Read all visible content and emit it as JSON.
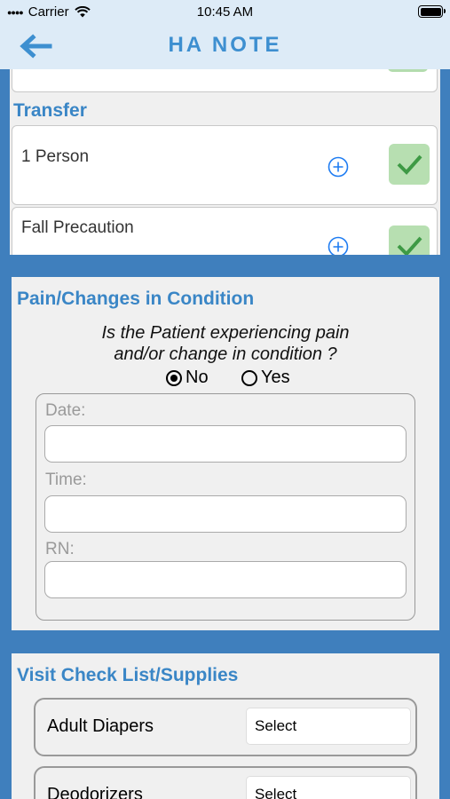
{
  "status_bar": {
    "carrier": "Carrier",
    "time": "10:45 AM"
  },
  "nav": {
    "title": "HA NOTE",
    "back_icon": "arrow-left-icon"
  },
  "transfer": {
    "title": "Transfer",
    "items": [
      {
        "label": "1 Person",
        "added_icon": "plus-circle-icon",
        "checked": true
      },
      {
        "label": "Fall Precaution",
        "added_icon": "plus-circle-icon",
        "checked": true
      }
    ]
  },
  "pain": {
    "title": "Pain/Changes in Condition",
    "question_line1": "Is the Patient experiencing pain",
    "question_line2": "and/or change in condition ?",
    "options": [
      {
        "label": "No",
        "selected": true
      },
      {
        "label": "Yes",
        "selected": false
      }
    ],
    "fields": [
      {
        "label": "Date:",
        "value": ""
      },
      {
        "label": "Time:",
        "value": ""
      },
      {
        "label": "RN:",
        "value": ""
      }
    ]
  },
  "visit": {
    "title": "Visit Check List/Supplies",
    "items": [
      {
        "label": "Adult Diapers",
        "select": "Select"
      },
      {
        "label": "Deodorizers",
        "select": "Select"
      }
    ]
  },
  "colors": {
    "accent": "#3d8fd0",
    "background": "#3f7fbd",
    "check_green": "#b7dfb1",
    "check_mark": "#3e9a45"
  }
}
